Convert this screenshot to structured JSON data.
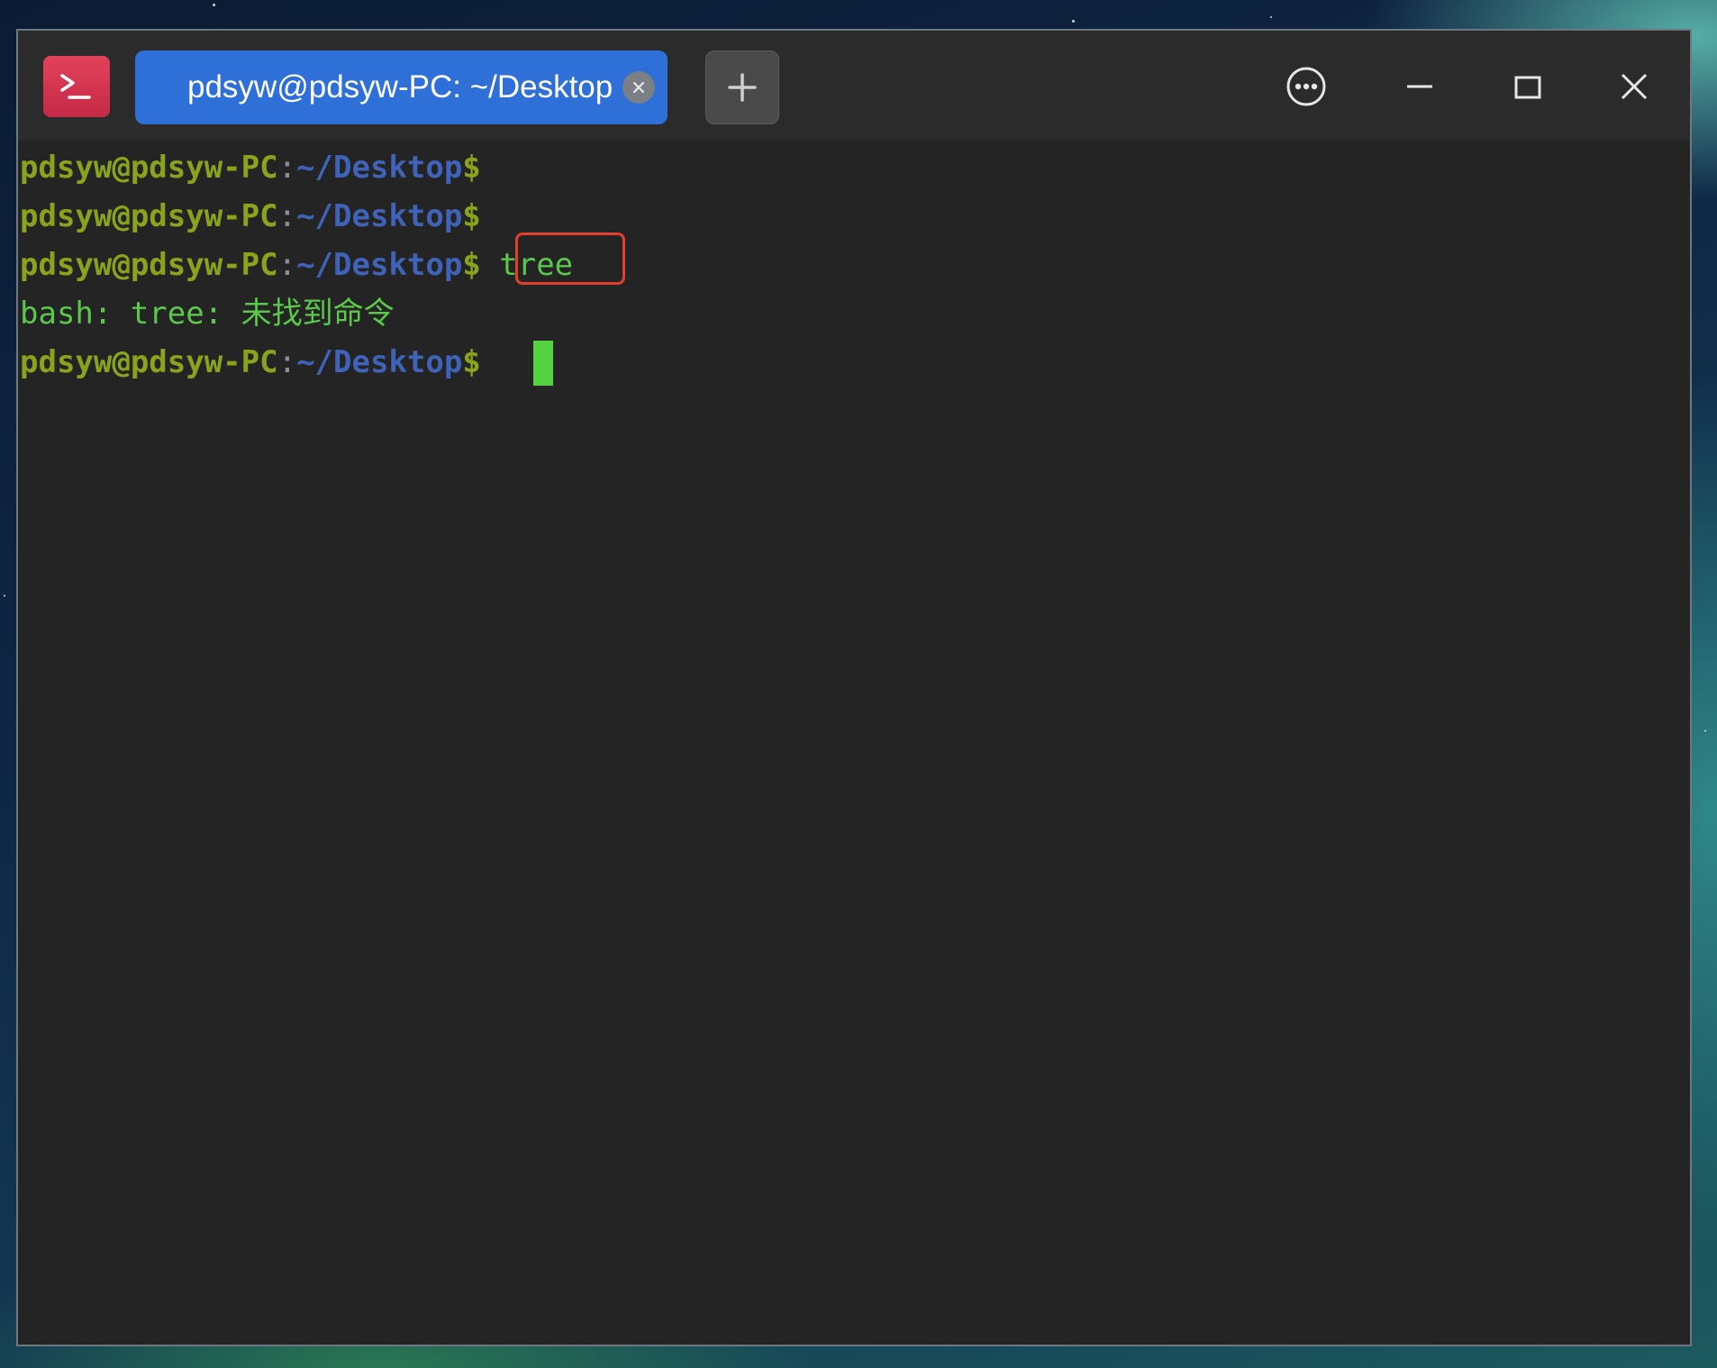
{
  "window": {
    "tab_title": "pdsyw@pdsyw-PC: ~/Desktop"
  },
  "icons": {
    "app": "terminal-prompt-icon",
    "tab_close": "close-icon",
    "new_tab": "plus-icon",
    "menu": "more-options-icon",
    "minimize": "minimize-icon",
    "maximize": "maximize-icon",
    "close": "close-icon"
  },
  "terminal": {
    "lines": [
      {
        "user": "pdsyw@pdsyw-PC",
        "colon": ":",
        "path": "~/Desktop",
        "dollar": "$",
        "command": ""
      },
      {
        "user": "pdsyw@pdsyw-PC",
        "colon": ":",
        "path": "~/Desktop",
        "dollar": "$",
        "command": ""
      },
      {
        "user": "pdsyw@pdsyw-PC",
        "colon": ":",
        "path": "~/Desktop",
        "dollar": "$",
        "command": " tree"
      },
      {
        "output": "bash: tree: 未找到命令"
      },
      {
        "user": "pdsyw@pdsyw-PC",
        "colon": ":",
        "path": "~/Desktop",
        "dollar": "$ ",
        "command": ""
      }
    ]
  },
  "colors": {
    "user": "#8aa31c",
    "path": "#3f63b9",
    "command": "#5ac84a",
    "cursor": "#55d23f",
    "highlight_box": "#e2402e",
    "tab_active": "#2f6fd8"
  }
}
